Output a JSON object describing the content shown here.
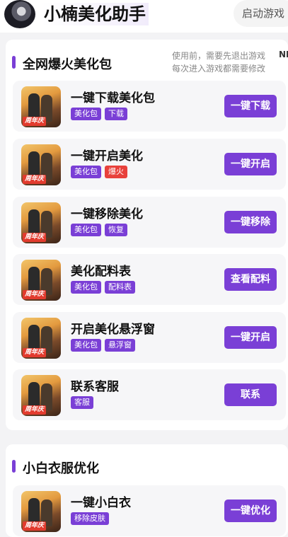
{
  "header": {
    "app_title": "小楠美化助手",
    "start_game_label": "启动游戏"
  },
  "section1": {
    "title": "全网爆火美化包",
    "notice_line1": "使用前，需要先退出游戏",
    "notice_line2": "每次进入游戏都需要修改",
    "notice_tag": "NE",
    "items": [
      {
        "title": "一键下载美化包",
        "tags": [
          "美化包",
          "下载"
        ],
        "button": "一键下载",
        "icon_badge": "周年庆"
      },
      {
        "title": "一键开启美化",
        "tags": [
          "美化包",
          "爆火"
        ],
        "button": "一键开启",
        "icon_badge": "周年庆"
      },
      {
        "title": "一键移除美化",
        "tags": [
          "美化包",
          "恢复"
        ],
        "button": "一键移除",
        "icon_badge": "周年庆"
      },
      {
        "title": "美化配料表",
        "tags": [
          "美化包",
          "配料表"
        ],
        "button": "查看配料",
        "icon_badge": "周年庆"
      },
      {
        "title": "开启美化悬浮窗",
        "tags": [
          "美化包",
          "悬浮窗"
        ],
        "button": "一键开启",
        "icon_badge": "周年庆"
      },
      {
        "title": "联系客服",
        "tags": [
          "客服"
        ],
        "button": "联系",
        "icon_badge": "周年庆"
      }
    ]
  },
  "section2": {
    "title": "小白衣服优化",
    "items": [
      {
        "title": "一键小白衣",
        "tags": [
          "移除皮肤"
        ],
        "button": "一键优化",
        "icon_badge": "周年庆"
      }
    ]
  },
  "colors": {
    "accent": "#7a3fd6",
    "hot_tag": "#e8413c",
    "row_bg": "#f6f6f8",
    "page_bg": "#f3f3f5"
  }
}
